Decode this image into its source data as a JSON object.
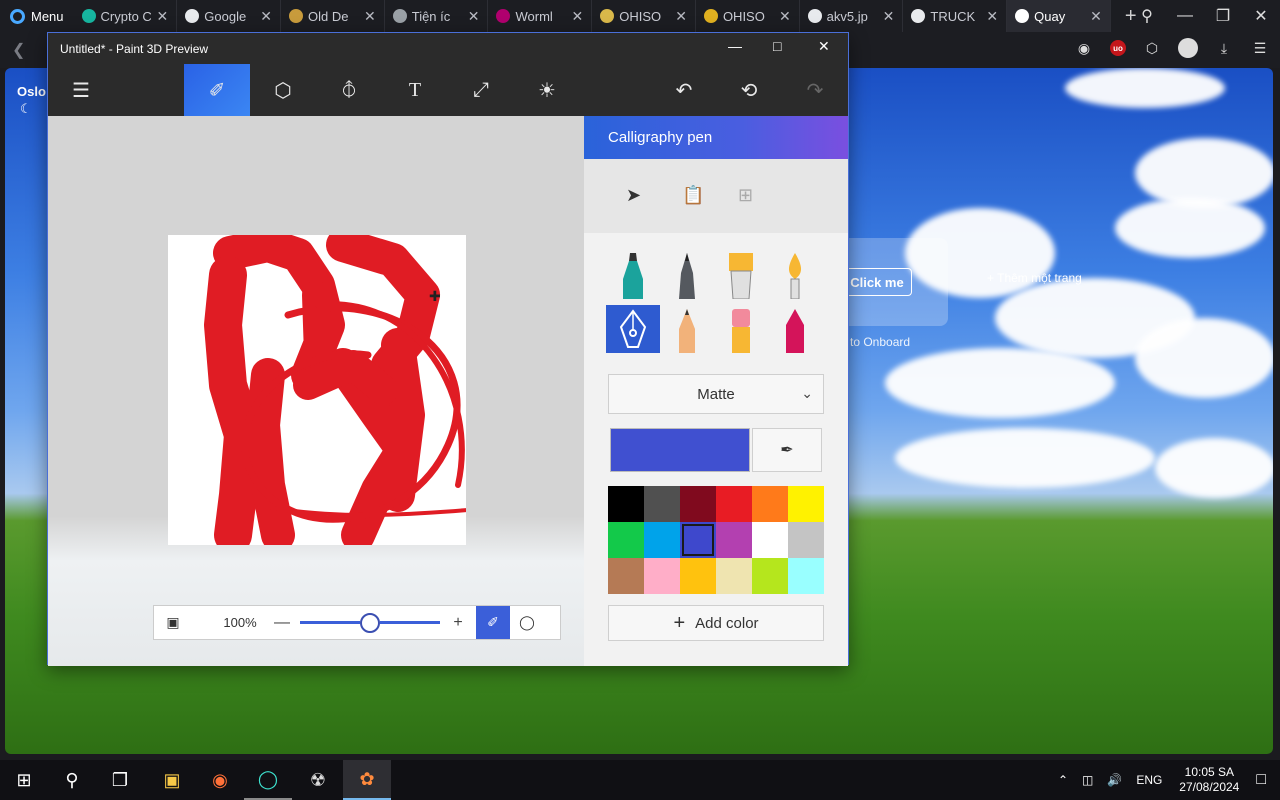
{
  "browser": {
    "menu_label": "Menu",
    "tabs": [
      {
        "label": "Crypto Com",
        "color": "#17b6a0"
      },
      {
        "label": "Google",
        "color": "#e8eaed"
      },
      {
        "label": "Old De",
        "color": "#c89b3c"
      },
      {
        "label": "Tiện íc",
        "color": "#9aa0a6"
      },
      {
        "label": "Worml",
        "color": "#b0006e"
      },
      {
        "label": "OHISO",
        "color": "#d9b84a"
      },
      {
        "label": "OHISO",
        "color": "#e0b020"
      },
      {
        "label": "akv5.jp",
        "color": "#e8eaed"
      },
      {
        "label": "TRUCK",
        "color": "#e8eaed"
      },
      {
        "label": "Quay",
        "color": "#ffffff"
      }
    ],
    "ub_label": "uo"
  },
  "desktop": {
    "weather_city": "Oslo",
    "click_me": "Click me",
    "add_page": "+ Thêm một trang",
    "onboard": "to Onboard"
  },
  "paint": {
    "title": "Untitled* - Paint 3D Preview",
    "toolbar": [
      "menu-icon",
      "brushes-icon",
      "3d-shapes-icon",
      "stickers-icon",
      "text-icon",
      "canvas-icon",
      "effects-icon",
      "undo-icon",
      "history-icon",
      "redo-icon"
    ],
    "panel_title": "Calligraphy pen",
    "finish_value": "Matte",
    "current_color": "#4050d0",
    "palette": [
      "#000000",
      "#505050",
      "#800a1e",
      "#e81c24",
      "#ff7a1a",
      "#fff200",
      "#13c94a",
      "#00a3ea",
      "#3e48cc",
      "#b340b0",
      "#ffffff",
      "#c4c4c4",
      "#b57a55",
      "#ffaec8",
      "#ffc20e",
      "#efe4b0",
      "#b5e61d",
      "#99ffff"
    ],
    "selected_swatch": 8,
    "add_color": "Add color",
    "zoom": {
      "percent_label": "100%",
      "level": 0.5
    }
  },
  "taskbar": {
    "language": "ENG",
    "time": "10:05 SA",
    "date": "27/08/2024"
  }
}
